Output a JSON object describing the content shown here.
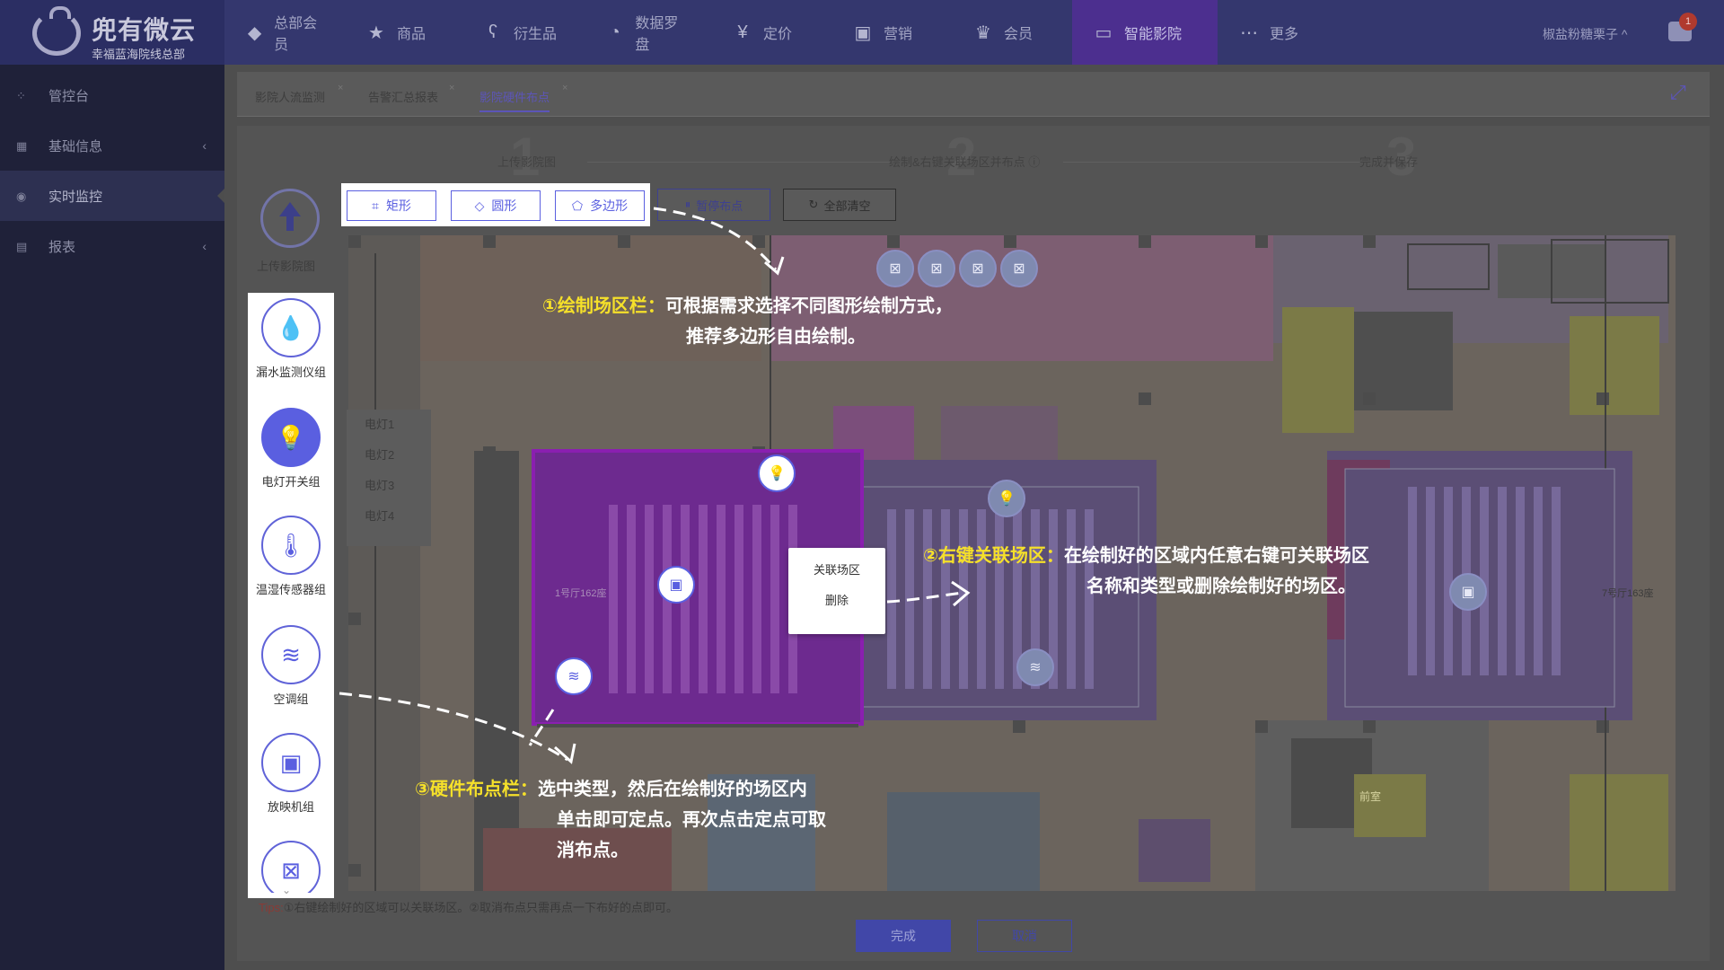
{
  "app": {
    "brand": "兜有微云",
    "subbrand": "幸福蓝海院线总部",
    "user": "椒盐粉糖栗子 ^",
    "message_count": "1"
  },
  "nav": [
    {
      "label": "总部会员",
      "icon": "diamond-icon"
    },
    {
      "label": "商品",
      "icon": "star-box-icon"
    },
    {
      "label": "衍生品",
      "icon": "bear-icon"
    },
    {
      "label": "数据罗盘",
      "icon": "pie-chart-icon"
    },
    {
      "label": "定价",
      "icon": "yen-icon"
    },
    {
      "label": "营销",
      "icon": "gift-icon"
    },
    {
      "label": "会员",
      "icon": "crown-icon"
    },
    {
      "label": "智能影院",
      "icon": "screen-icon"
    },
    {
      "label": "更多",
      "icon": "more-icon"
    }
  ],
  "sidebar": [
    {
      "label": "管控台",
      "icon": "dashboard-icon"
    },
    {
      "label": "基础信息",
      "icon": "grid-icon",
      "chevron": "‹"
    },
    {
      "label": "实时监控",
      "icon": "monitor-icon"
    },
    {
      "label": "报表",
      "icon": "report-icon",
      "chevron": "‹"
    }
  ],
  "tabs": [
    "影院人流监测",
    "告警汇总报表",
    "影院硬件布点"
  ],
  "steps": [
    {
      "num": "1",
      "label": "上传影院图"
    },
    {
      "num": "2",
      "label": "绘制&右键关联场区并布点 ⓘ"
    },
    {
      "num": "3",
      "label": "完成并保存"
    }
  ],
  "upload_label": "上传影院图",
  "draw_tools": [
    "矩形",
    "圆形",
    "多边形"
  ],
  "actions": {
    "pause": "暂停布点",
    "clear": "全部清空"
  },
  "hardware": [
    {
      "label": "漏水监测仪组",
      "icon": "water-drop-icon"
    },
    {
      "label": "电灯开关组",
      "icon": "light-bulb-icon"
    },
    {
      "label": "温湿传感器组",
      "icon": "thermometer-icon"
    },
    {
      "label": "空调组",
      "icon": "air-conditioner-icon"
    },
    {
      "label": "放映机组",
      "icon": "projector-icon"
    },
    {
      "label": "",
      "icon": "speaker-group-icon"
    }
  ],
  "lamps": [
    "电灯1",
    "电灯2",
    "电灯3",
    "电灯4"
  ],
  "context_menu": [
    "关联场区",
    "删除"
  ],
  "annotations": {
    "a1_title": "①绘制场区栏：",
    "a1_line1": "可根据需求选择不同图形绘制方式，",
    "a1_line2": "推荐多边形自由绘制。",
    "a2_title": "②右键关联场区：",
    "a2_line1": "在绘制好的区域内任意右键可关联场区",
    "a2_line2": "名称和类型或删除绘制好的场区。",
    "a3_title": "③硬件布点栏：",
    "a3_line1": "选中类型，然后在绘制好的场区内",
    "a3_line2": "单击即可定点。再次点击定点可取",
    "a3_line3": "消布点。"
  },
  "floor_labels": {
    "hall1": "1号厅162座",
    "hall7": "7号厅163座",
    "lobby": "前室"
  },
  "tips_prefix": "Tips:",
  "tips": "①右键绘制好的区域可以关联场区。②取消布点只需再点一下布好的点即可。",
  "buttons": {
    "done": "完成",
    "cancel": "取消"
  },
  "colors": {
    "accent": "#5a5fe0",
    "highlight": "#f5e02a",
    "purple_zone": "#6d2a8f"
  }
}
